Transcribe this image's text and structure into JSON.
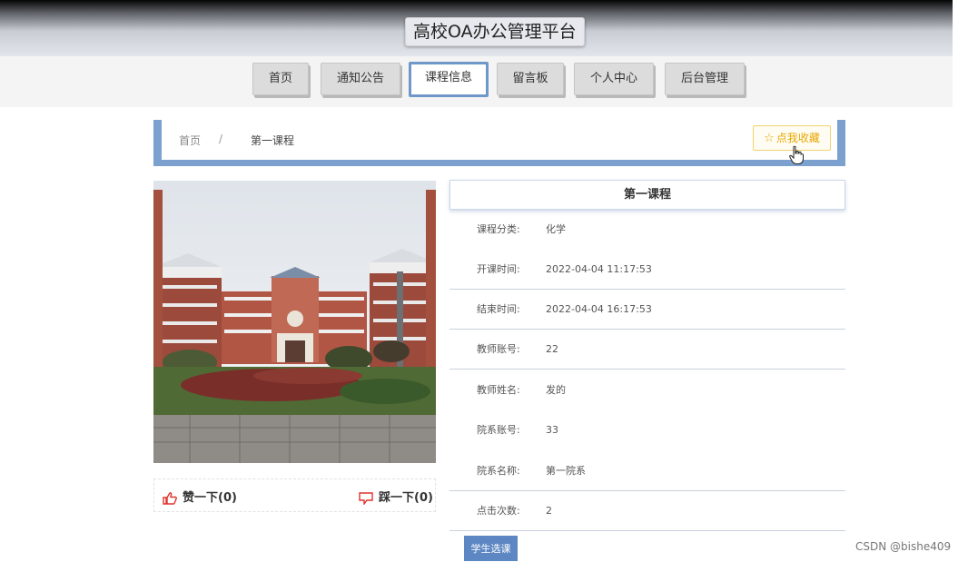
{
  "header": {
    "title": "高校OA办公管理平台"
  },
  "nav": {
    "items": [
      {
        "label": "首页"
      },
      {
        "label": "通知公告"
      },
      {
        "label": "课程信息"
      },
      {
        "label": "留言板"
      },
      {
        "label": "个人中心"
      },
      {
        "label": "后台管理"
      }
    ],
    "active_index": 2
  },
  "breadcrumb": {
    "home": "首页",
    "separator": "/",
    "current": "第一课程"
  },
  "favorite": {
    "label": "点我收藏",
    "icon": "star-outline-icon"
  },
  "course": {
    "title": "第一课程",
    "fields": [
      {
        "label": "课程分类:",
        "value": "化学"
      },
      {
        "label": "开课时间:",
        "value": "2022-04-04 11:17:53"
      },
      {
        "label": "结束时间:",
        "value": "2022-04-04 16:17:53"
      },
      {
        "label": "教师账号:",
        "value": "22"
      },
      {
        "label": "教师姓名:",
        "value": "发的"
      },
      {
        "label": "院系账号:",
        "value": "33"
      },
      {
        "label": "院系名称:",
        "value": "第一院系"
      },
      {
        "label": "点击次数:",
        "value": "2"
      }
    ]
  },
  "votes": {
    "like_label": "赞一下(0)",
    "dislike_label": "踩一下(0)"
  },
  "actions": {
    "select_label": "学生选课"
  },
  "watermark": "CSDN @bishe409",
  "colors": {
    "accent": "#7da1cf",
    "button": "#5d87c2",
    "favorite": "#e8a600",
    "vote_icon": "#e0322b"
  }
}
